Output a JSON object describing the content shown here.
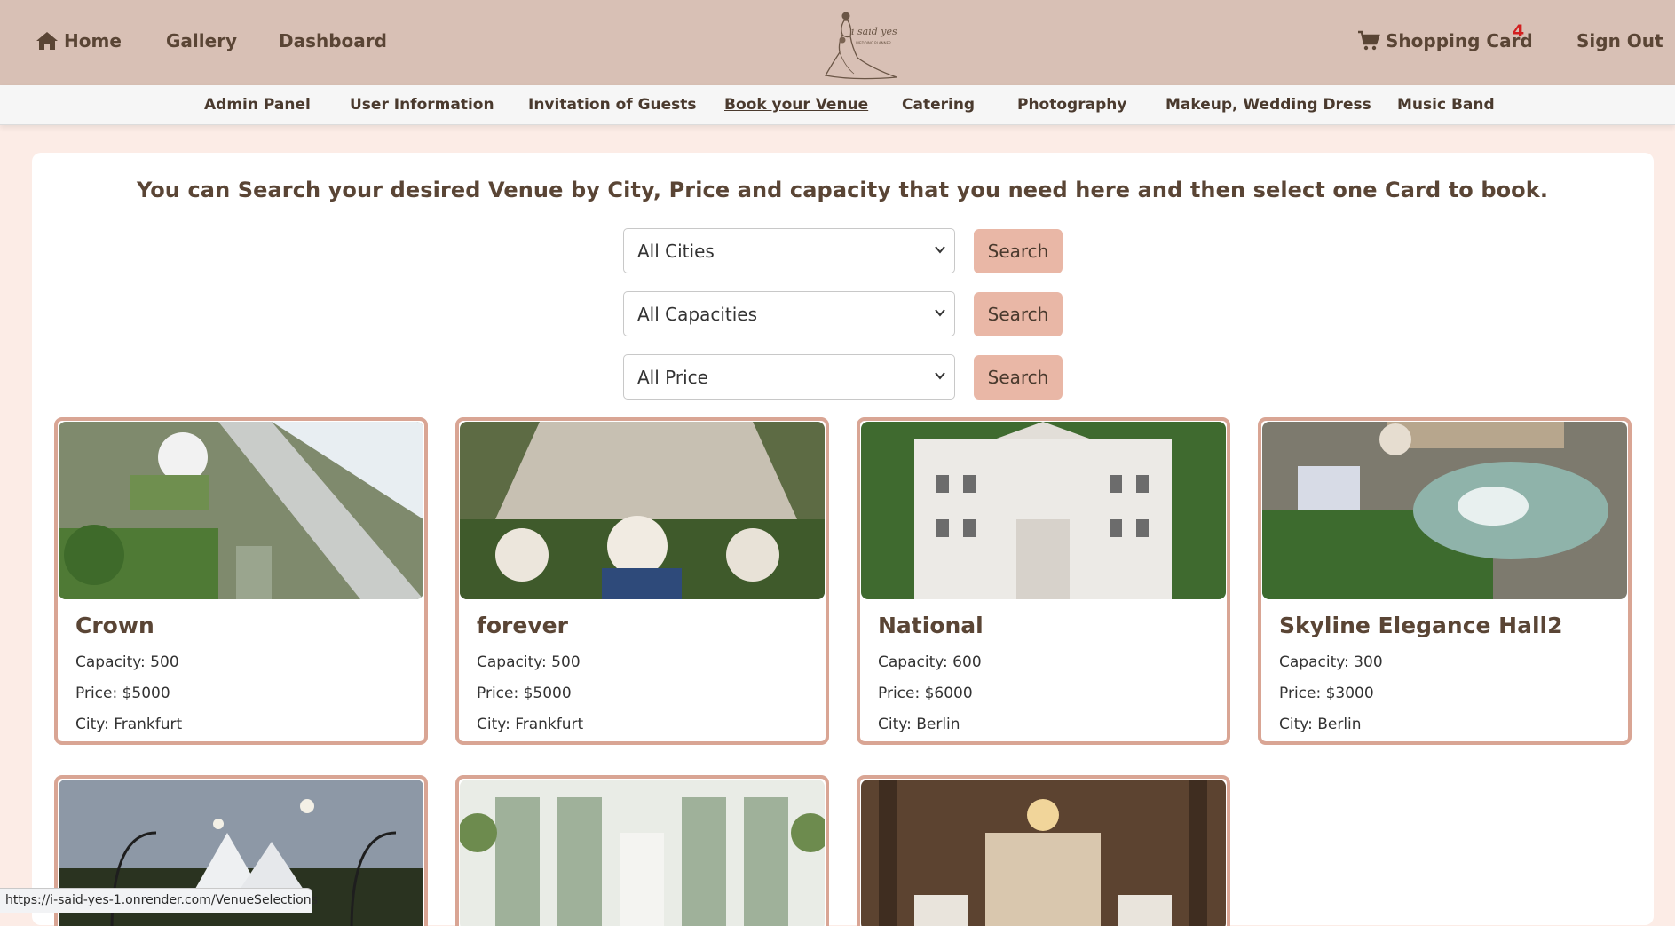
{
  "topbar": {
    "home_label": "Home",
    "gallery_label": "Gallery",
    "dashboard_label": "Dashboard",
    "cart_label": "Shopping Card",
    "cart_count": "4",
    "signout_label": "Sign Out",
    "logo_text": "i said yes",
    "logo_subtext": "WEDDING PLANNER"
  },
  "subnav": {
    "items": [
      {
        "label": "Admin Panel"
      },
      {
        "label": "User Information"
      },
      {
        "label": "Invitation of Guests"
      },
      {
        "label": "Book your Venue"
      },
      {
        "label": "Catering"
      },
      {
        "label": "Photography"
      },
      {
        "label": "Makeup, Wedding Dress"
      },
      {
        "label": "Music Band"
      }
    ]
  },
  "main": {
    "headline": "You can Search your desired Venue by City, Price and capacity that you need here and then select one Card to book.",
    "filters": [
      {
        "value": "All Cities",
        "button": "Search"
      },
      {
        "value": "All Capacities",
        "button": "Search"
      },
      {
        "value": "All Price",
        "button": "Search"
      }
    ]
  },
  "venues": [
    {
      "name": "Crown",
      "capacity": "Capacity: 500",
      "price": "Price: $5000",
      "city": "City: Frankfurt"
    },
    {
      "name": "forever",
      "capacity": "Capacity: 500",
      "price": "Price: $5000",
      "city": "City: Frankfurt"
    },
    {
      "name": "National",
      "capacity": "Capacity: 600",
      "price": "Price: $6000",
      "city": "City: Berlin"
    },
    {
      "name": "Skyline Elegance Hall2",
      "capacity": "Capacity: 300",
      "price": "Price: $3000",
      "city": "City: Berlin"
    }
  ],
  "status_url": "https://i-said-yes-1.onrender.com/VenueSelections",
  "colors": {
    "topbar_bg": "#d8c0b5",
    "page_bg": "#fcece6",
    "card_border": "#d9a594",
    "button_bg": "#e9b7a6",
    "badge": "#d21f1f"
  }
}
